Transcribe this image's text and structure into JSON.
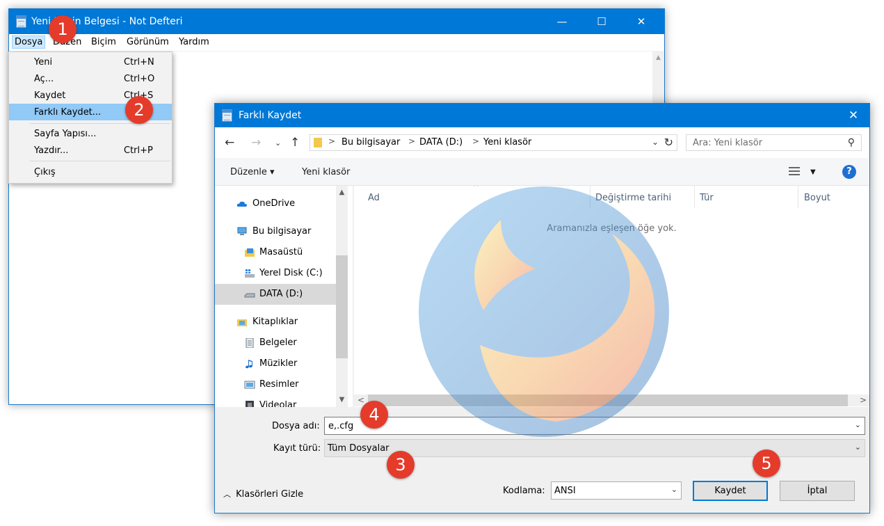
{
  "notepad": {
    "title": "Yeni Metin Belgesi - Not Defteri",
    "controls": {
      "minimize": "—",
      "maximize": "☐",
      "close": "✕"
    },
    "menubar": [
      "Dosya",
      "Düzen",
      "Biçim",
      "Görünüm",
      "Yardım"
    ],
    "file_menu": [
      {
        "label": "Yeni",
        "shortcut": "Ctrl+N"
      },
      {
        "label": "Aç...",
        "shortcut": "Ctrl+O"
      },
      {
        "label": "Kaydet",
        "shortcut": "Ctrl+S"
      },
      {
        "label": "Farklı Kaydet...",
        "shortcut": ""
      },
      {
        "label": "Sayfa Yapısı...",
        "shortcut": ""
      },
      {
        "label": "Yazdır...",
        "shortcut": "Ctrl+P"
      },
      {
        "label": "Çıkış",
        "shortcut": ""
      }
    ]
  },
  "dialog": {
    "title": "Farklı Kaydet",
    "breadcrumb": [
      "Bu bilgisayar",
      "DATA (D:)",
      "Yeni klasör"
    ],
    "search_placeholder": "Ara: Yeni klasör",
    "toolbar": {
      "organize": "Düzenle ▾",
      "new_folder": "Yeni klasör"
    },
    "nav_items": [
      {
        "label": "OneDrive",
        "icon": "cloud-icon"
      },
      {
        "label": "Bu bilgisayar",
        "icon": "computer-icon"
      },
      {
        "label": "Masaüstü",
        "icon": "desktop-folder-icon"
      },
      {
        "label": "Yerel Disk (C:)",
        "icon": "windows-drive-icon"
      },
      {
        "label": "DATA (D:)",
        "icon": "drive-icon",
        "selected": true
      },
      {
        "label": "Kitaplıklar",
        "icon": "libraries-icon"
      },
      {
        "label": "Belgeler",
        "icon": "documents-icon"
      },
      {
        "label": "Müzikler",
        "icon": "music-icon"
      },
      {
        "label": "Resimler",
        "icon": "pictures-icon"
      },
      {
        "label": "Videolar",
        "icon": "videos-icon"
      }
    ],
    "columns": [
      "Ad",
      "Değiştirme tarihi",
      "Tür",
      "Boyut"
    ],
    "empty_message": "Aramanızla eşleşen öğe yok.",
    "filename_label": "Dosya adı:",
    "filename_value": "e,.cfg",
    "filetype_label": "Kayıt türü:",
    "filetype_value": "Tüm Dosyalar",
    "hide_folders": "Klasörleri Gizle",
    "encoding_label": "Kodlama:",
    "encoding_value": "ANSI",
    "save_button": "Kaydet",
    "cancel_button": "İptal"
  },
  "markers": [
    "1",
    "2",
    "3",
    "4",
    "5"
  ],
  "colors": {
    "titlebar": "#0078d7",
    "marker": "#e43b2b",
    "highlight": "#91c9f7"
  }
}
